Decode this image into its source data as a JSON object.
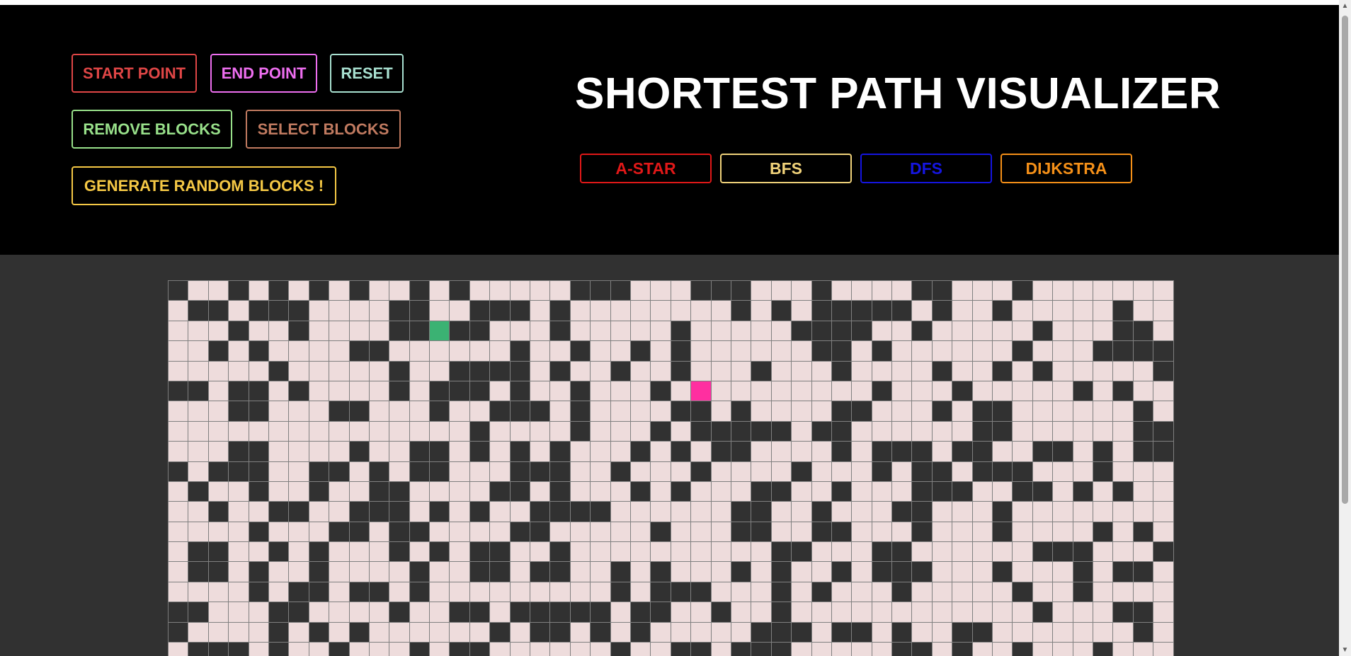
{
  "controls": {
    "start_point": {
      "label": "START POINT",
      "color": "#e04646"
    },
    "end_point": {
      "label": "END POINT",
      "color": "#ee6ef0"
    },
    "reset": {
      "label": "RESET",
      "color": "#a8e0d0"
    },
    "remove_blocks": {
      "label": "REMOVE BLOCKS",
      "color": "#98e08a"
    },
    "select_blocks": {
      "label": "SELECT BLOCKS",
      "color": "#c07a60"
    },
    "generate_random": {
      "label": "GENERATE RANDOM BLOCKS !",
      "color": "#f5c845"
    }
  },
  "title": "SHORTEST PATH VISUALIZER",
  "algorithms": [
    {
      "label": "A-STAR",
      "color": "#e01818"
    },
    {
      "label": "BFS",
      "color": "#f0d27a"
    },
    {
      "label": "DFS",
      "color": "#1515e0"
    },
    {
      "label": "DIJKSTRA",
      "color": "#f59018"
    }
  ],
  "grid": {
    "cols": 50,
    "rows": 19,
    "start_cell": [
      2,
      13
    ],
    "end_cell": [
      5,
      26
    ],
    "colors": {
      "open": "#eedcdc",
      "wall": "#313131",
      "start": "#3bb273",
      "end": "#ff2fa0"
    }
  }
}
